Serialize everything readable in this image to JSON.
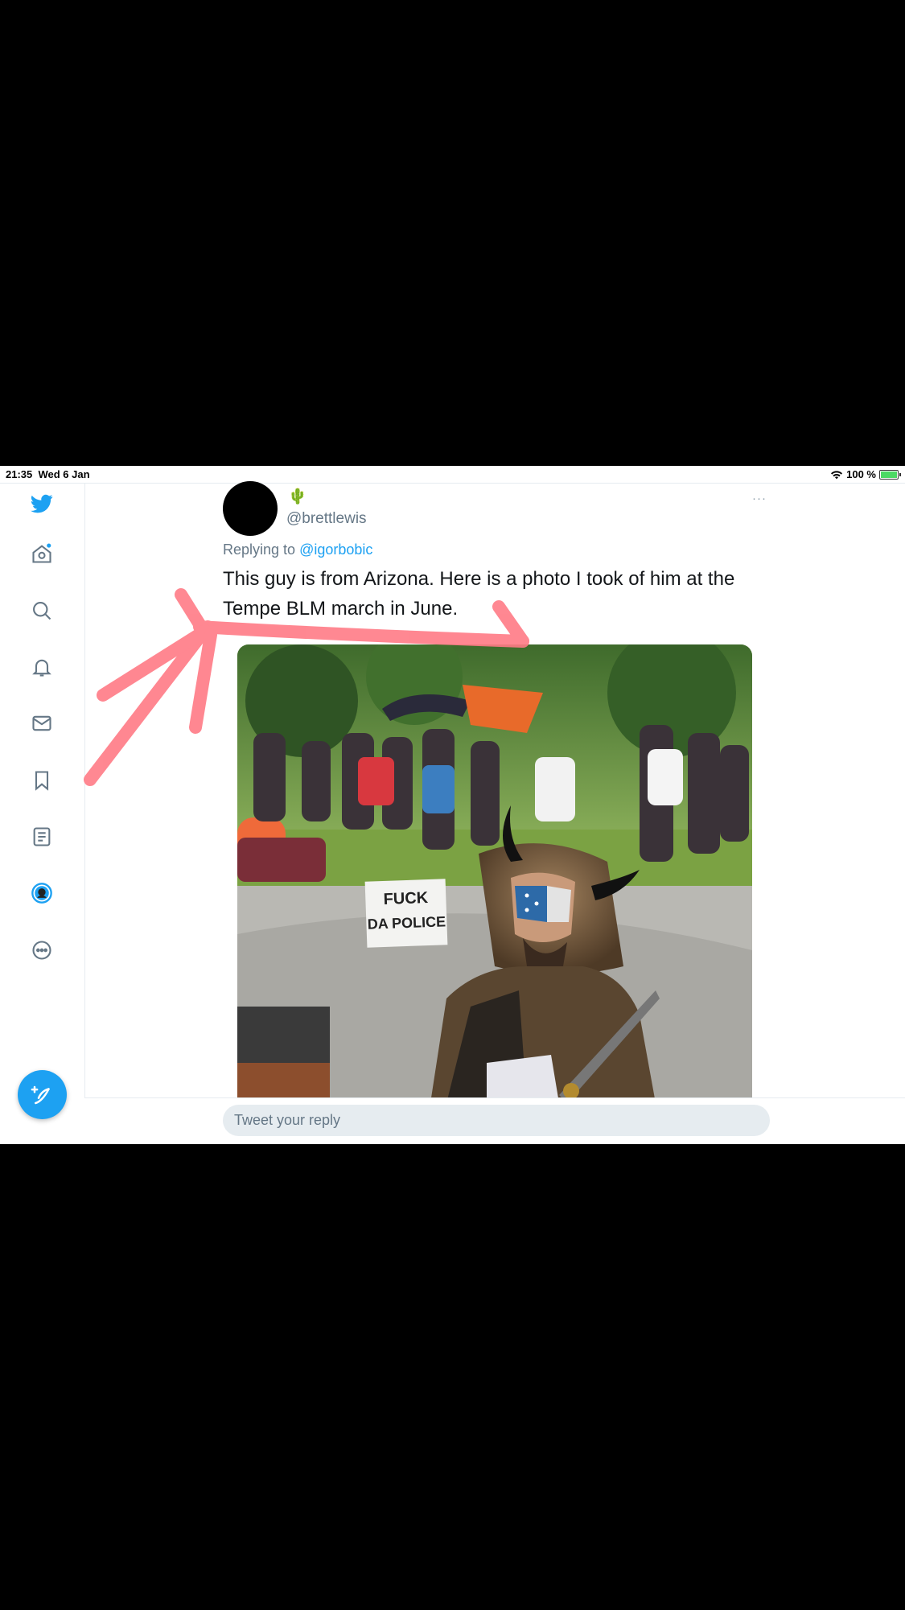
{
  "status_bar": {
    "time": "21:35",
    "date": "Wed 6 Jan",
    "battery": "100 %"
  },
  "sidebar": {
    "items": [
      {
        "icon": "twitter-logo-icon"
      },
      {
        "icon": "home-icon"
      },
      {
        "icon": "search-icon"
      },
      {
        "icon": "bell-icon"
      },
      {
        "icon": "mail-icon"
      },
      {
        "icon": "bookmark-icon"
      },
      {
        "icon": "list-icon"
      },
      {
        "icon": "profile-avatar-icon"
      },
      {
        "icon": "more-icon"
      }
    ],
    "compose_icon": "compose-tweet-icon"
  },
  "tweet": {
    "emoji": "🌵",
    "handle": "@brettlewis",
    "more": "···",
    "replying_prefix": "Replying to",
    "replying_to": "@igorbobic",
    "text": "This guy is from Arizona. Here is a photo I took of him at the Tempe BLM march in June.",
    "photo_sign": "FUCK DA POLICE"
  },
  "reply": {
    "placeholder": "Tweet your reply"
  },
  "colors": {
    "accent": "#1da1f2",
    "annotation": "#ff7b86",
    "muted": "#657786"
  }
}
